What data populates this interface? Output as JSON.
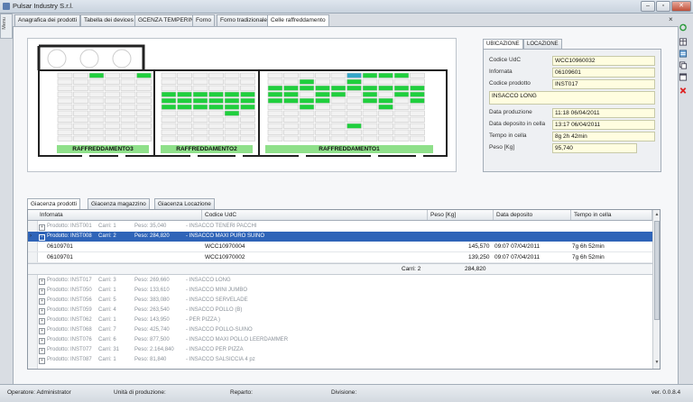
{
  "window": {
    "title": "Pulsar Industry S.r.l."
  },
  "side_tab": "Menu",
  "tabs": [
    {
      "label": "Anagrafica dei prodotti"
    },
    {
      "label": "Tabella dei devices"
    },
    {
      "label": "GCENZA TEMPERING"
    },
    {
      "label": "Forno"
    },
    {
      "label": "Forno tradizionale"
    },
    {
      "label": "Celle raffreddamento"
    }
  ],
  "doc_close": "×",
  "map": {
    "rooms": [
      {
        "label": "RAFFREDDAMENTO3"
      },
      {
        "label": "RAFFREDDAMENTO2"
      },
      {
        "label": "RAFFREDDAMENTO1"
      }
    ]
  },
  "info": {
    "tabs": [
      {
        "label": "UBICAZIONE"
      },
      {
        "label": "LOCAZIONE"
      }
    ],
    "codice_udc_label": "Codice UdC",
    "codice_udc": "WCC10960032",
    "informata_label": "Infornata",
    "informata": "06109601",
    "codice_prodotto_label": "Codice prodotto",
    "codice_prodotto": "INST017",
    "descrizione": "INSACCO LONG",
    "data_produzione_label": "Data produzione",
    "data_produzione": "11:18 06/04/2011",
    "data_deposito_label": "Data deposito in cella",
    "data_deposito": "13:17 06/04/2011",
    "tempo_label": "Tempo in cella",
    "tempo": "8g 2h 42min",
    "peso_label": "Peso [Kg]",
    "peso": "95,740"
  },
  "bottom_tabs": [
    {
      "label": "Giacenza prodotti"
    },
    {
      "label": "Giacenza magazzino"
    },
    {
      "label": "Giacenza Locazione"
    }
  ],
  "grid": {
    "columns": [
      "Infornata",
      "Codice UdC",
      "Peso [Kg]",
      "Data deposito",
      "Tempo in cella"
    ],
    "groups_top": [
      {
        "exp": "+",
        "prodotto": "Prodotto: INST001",
        "carri": "Carri: 1",
        "peso": "Peso: 35,040",
        "desc": "- INSACCO TENERI PACCHI"
      },
      {
        "exp": "−",
        "prodotto": "Prodotto: INST008",
        "carri": "Carri: 2",
        "peso": "Peso: 284,820",
        "desc": "- INSACCO MAXI PURO SUINO"
      }
    ],
    "detail_rows": [
      {
        "infornata": "06109701",
        "udc": "WCC10970004",
        "peso": "145,570",
        "data": "09:07 07/04/2011",
        "tempo": "7g 6h 52min"
      },
      {
        "infornata": "06109701",
        "udc": "WCC10970002",
        "peso": "139,250",
        "data": "09:07 07/04/2011",
        "tempo": "7g 6h 52min"
      }
    ],
    "summary": {
      "carri": "Carri: 2",
      "peso": "284,820"
    },
    "groups_bottom": [
      {
        "prodotto": "Prodotto: INST017",
        "carri": "Carri: 3",
        "peso": "Peso: 269,660",
        "desc": "- INSACCO LONG"
      },
      {
        "prodotto": "Prodotto: INST050",
        "carri": "Carri: 1",
        "peso": "Peso: 133,610",
        "desc": "- INSACCO MINI JUMBO"
      },
      {
        "prodotto": "Prodotto: INST056",
        "carri": "Carri: 5",
        "peso": "Peso: 383,080",
        "desc": "- INSACCO SERVELADE"
      },
      {
        "prodotto": "Prodotto: INST059",
        "carri": "Carri: 4",
        "peso": "Peso: 263,540",
        "desc": "- INSACCO POLLO (B)"
      },
      {
        "prodotto": "Prodotto: INST062",
        "carri": "Carri: 1",
        "peso": "Peso: 143,950",
        "desc": "- PER PIZZA              )"
      },
      {
        "prodotto": "Prodotto: INST068",
        "carri": "Carri: 7",
        "peso": "Peso: 425,740",
        "desc": "- INSACCO POLLO-SUINO"
      },
      {
        "prodotto": "Prodotto: INST076",
        "carri": "Carri: 6",
        "peso": "Peso: 877,500",
        "desc": "- INSACCO MAXI POLLO LEERDAMMER"
      },
      {
        "prodotto": "Prodotto: INST077",
        "carri": "Carri: 31",
        "peso": "Peso: 2.164,840",
        "desc": "- INSACCO PER PIZZA"
      },
      {
        "prodotto": "Prodotto: INST087",
        "carri": "Carri: 1",
        "peso": "Peso: 81,840",
        "desc": "- INSACCO SALSICCIA 4 pz"
      }
    ]
  },
  "status": {
    "operatore": "Operatore: Administrator",
    "unita": "Unità di produzione:",
    "reparto": "Reparto:",
    "divisione": "Divisione:",
    "version": "ver. 0.0.8.4"
  }
}
